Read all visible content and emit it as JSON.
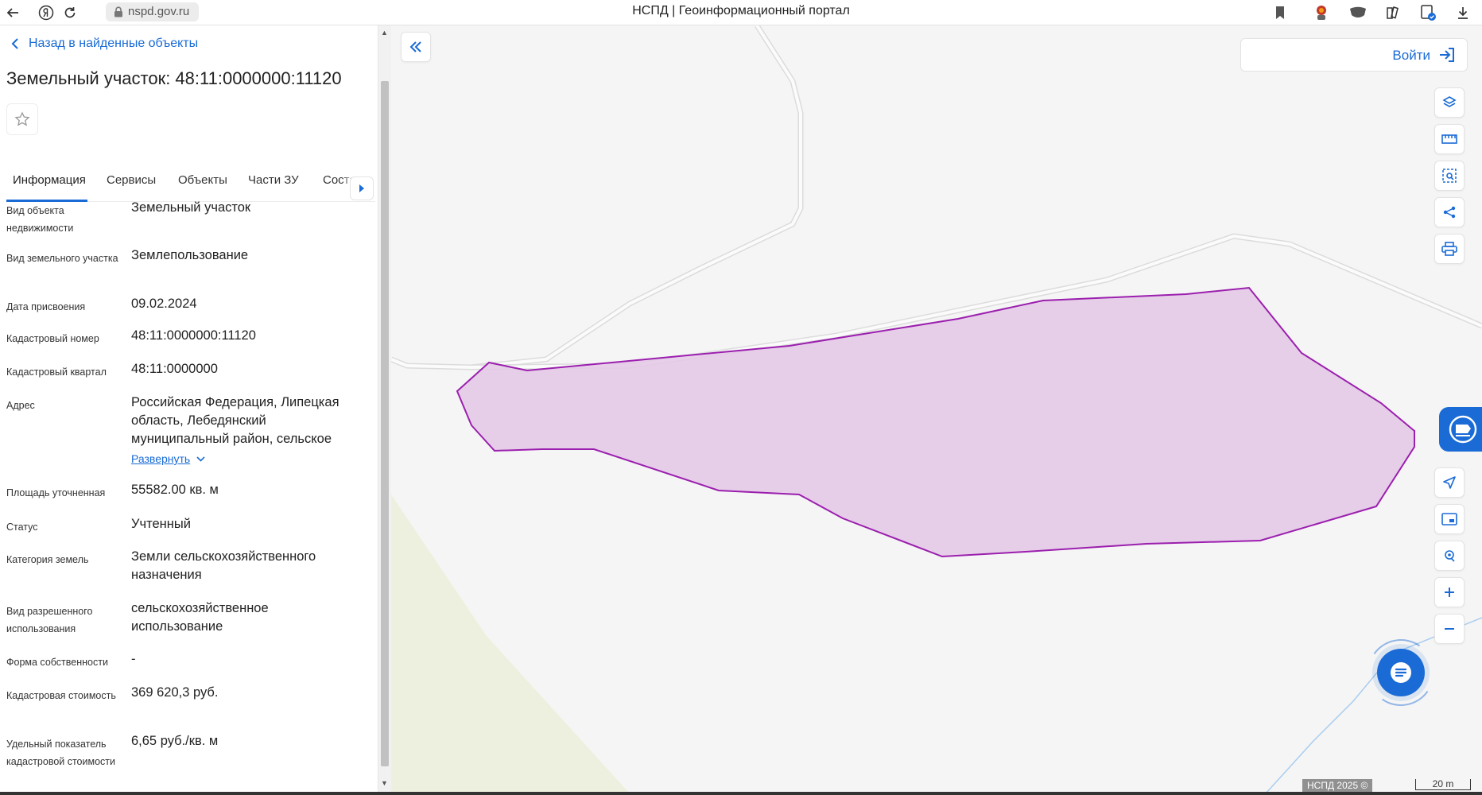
{
  "browser": {
    "url": "nspd.gov.ru",
    "page_title": "НСПД | Геоинформационный портал",
    "icons": [
      "back-arrow-icon",
      "yandex-icon",
      "reload-icon",
      "lock-icon",
      "bookmark-icon",
      "extension-icon",
      "download-icon"
    ]
  },
  "panel": {
    "back_label": "Назад в найденные объекты",
    "title": "Земельный участок: 48:11:0000000:11120",
    "tabs": [
      "Информация",
      "Сервисы",
      "Объекты",
      "Части ЗУ",
      "Состав"
    ],
    "active_tab": "Информация",
    "properties": [
      {
        "label": "Вид объекта недвижимости",
        "value": "Земельный участок"
      },
      {
        "label": "Вид земельного участка",
        "value": "Землепользование"
      },
      {
        "label": "Дата присвоения",
        "value": "09.02.2024"
      },
      {
        "label": "Кадастровый номер",
        "value": "48:11:0000000:11120"
      },
      {
        "label": "Кадастровый квартал",
        "value": "48:11:0000000"
      },
      {
        "label": "Адрес",
        "value": "Российская Федерация, Липецкая область, Лебедянский муниципальный район, сельское",
        "expand_label": "Развернуть"
      },
      {
        "label": "Площадь уточненная",
        "value": "55582.00 кв. м"
      },
      {
        "label": "Статус",
        "value": "Учтенный"
      },
      {
        "label": "Категория земель",
        "value": "Земли сельскохозяйственного назначения"
      },
      {
        "label": "Вид разрешенного использования",
        "value": "сельскохозяйственное использование"
      },
      {
        "label": "Форма собственности",
        "value": "-"
      },
      {
        "label": "Кадастровая стоимость",
        "value": "369 620,3 руб."
      },
      {
        "label": "Удельный показатель кадастровой стоимости",
        "value": "6,65 руб./кв. м"
      }
    ]
  },
  "map": {
    "login_label": "Войти",
    "copyright": "НСПД 2025 ©",
    "scale_label": "20 m",
    "parcel_fill": "#e4c8e7",
    "parcel_stroke": "#9b1fae",
    "accent": "#1a6bd6",
    "tools": [
      "layers-icon",
      "ruler-icon",
      "select-area-icon",
      "share-icon",
      "print-icon"
    ],
    "nav_tools": [
      "locate-icon",
      "minimap-icon",
      "geolocation-icon",
      "zoom-in-icon",
      "zoom-out-icon"
    ]
  }
}
